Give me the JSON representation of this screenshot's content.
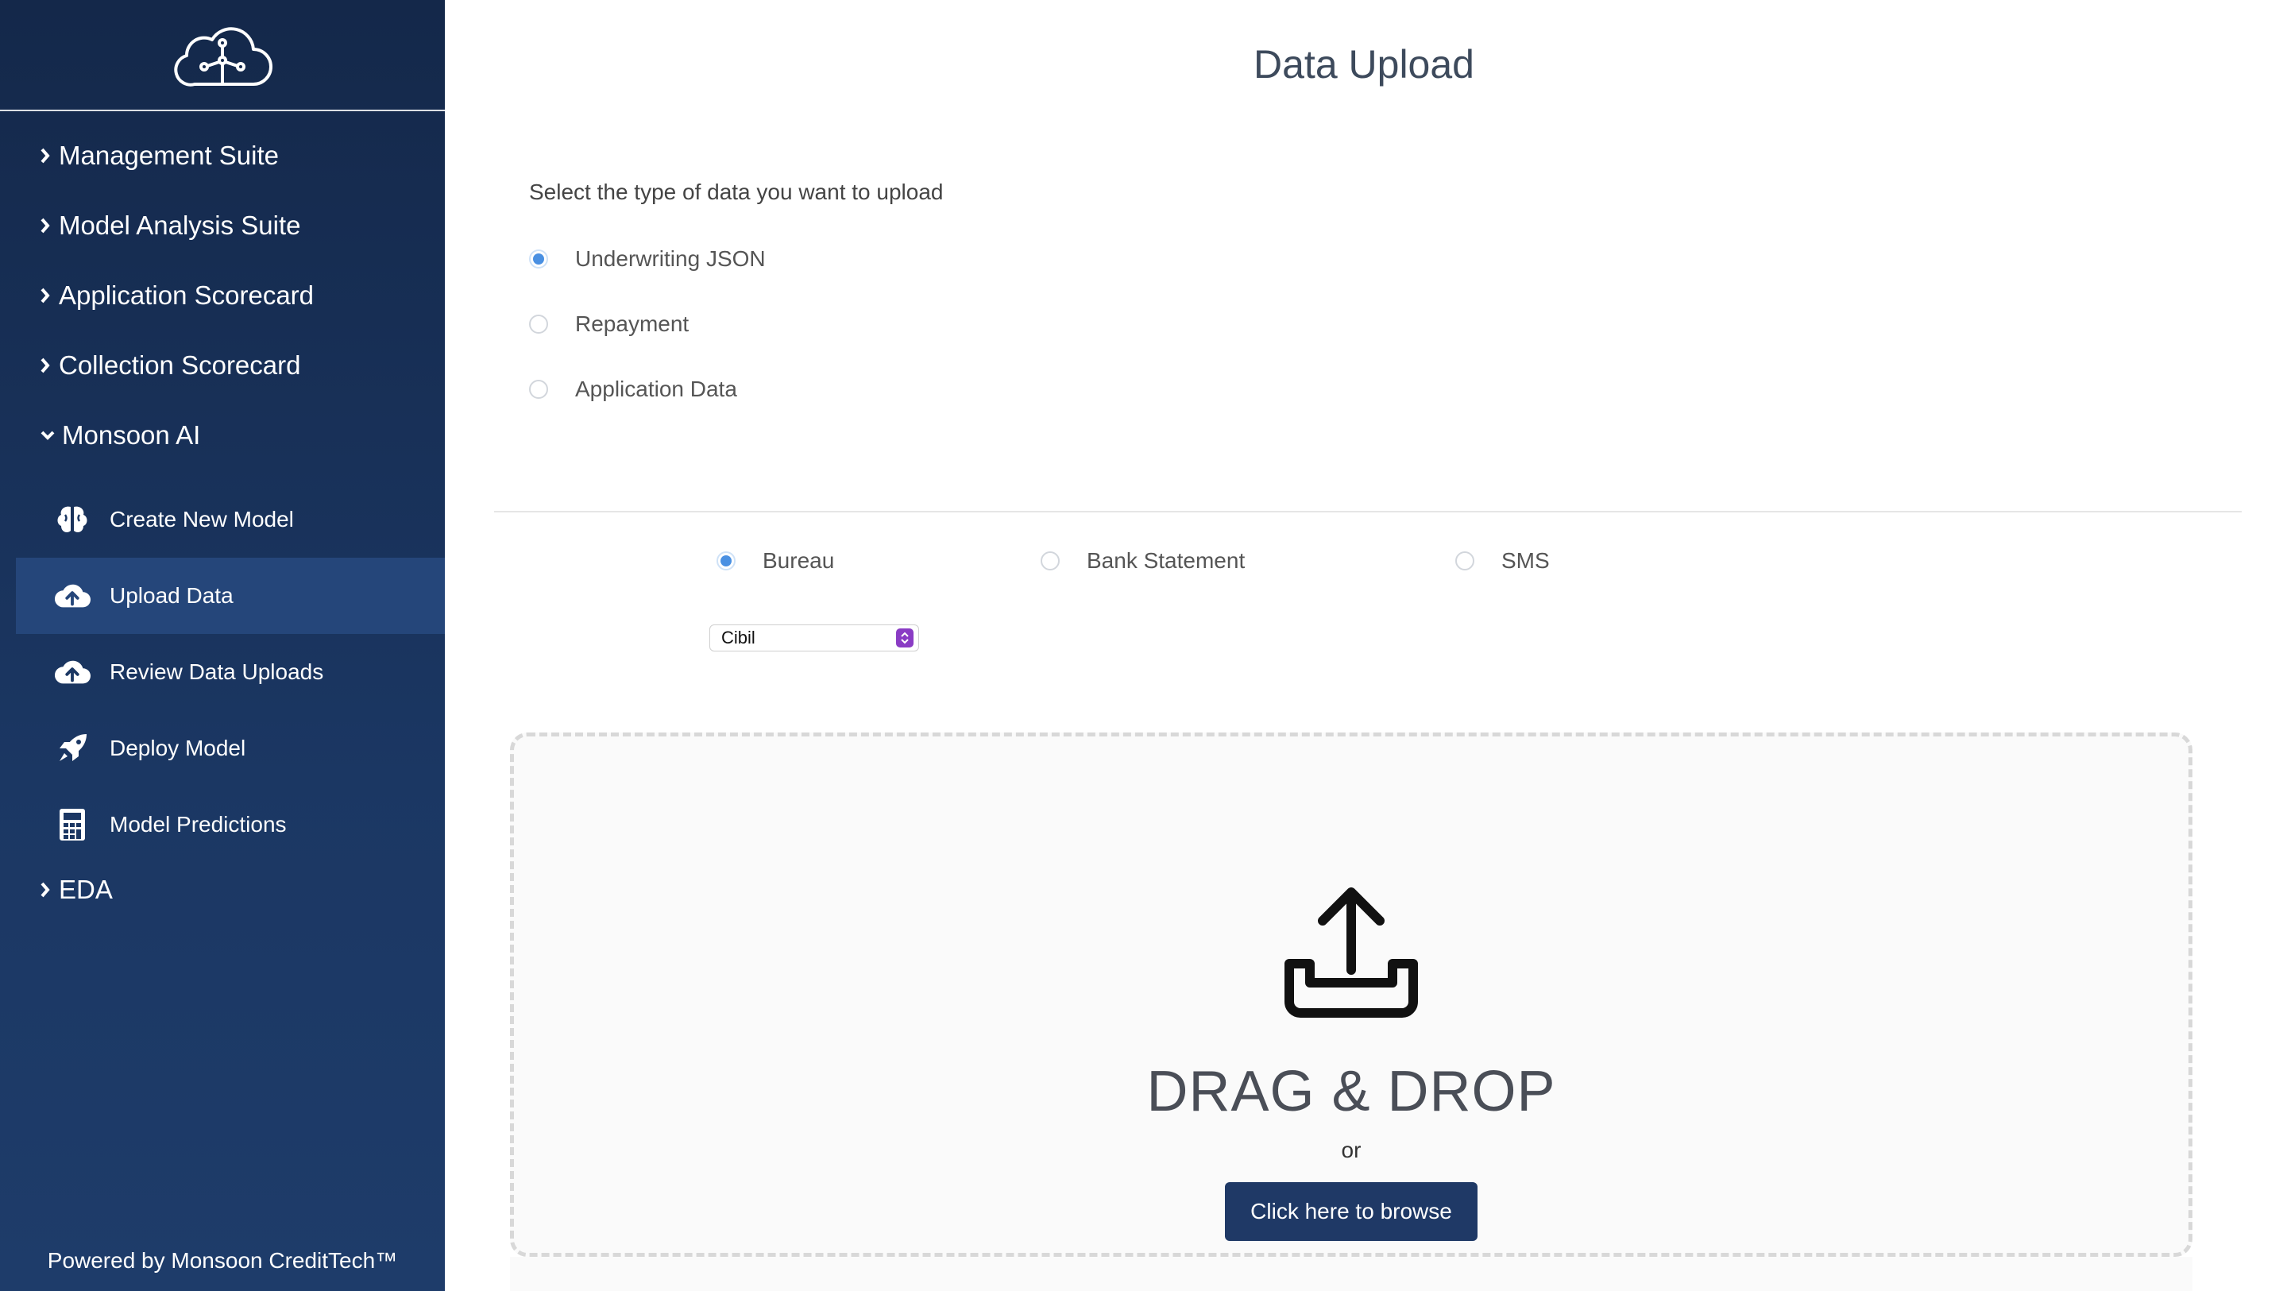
{
  "sidebar": {
    "logo_icon": "cloud-network-icon",
    "items": [
      {
        "label": "Management Suite",
        "expanded": false
      },
      {
        "label": "Model Analysis Suite",
        "expanded": false
      },
      {
        "label": "Application Scorecard",
        "expanded": false
      },
      {
        "label": "Collection Scorecard",
        "expanded": false
      },
      {
        "label": "Monsoon AI",
        "expanded": true
      }
    ],
    "sub_items": [
      {
        "label": "Create New Model",
        "icon": "brain-icon"
      },
      {
        "label": "Upload Data",
        "icon": "cloud-upload-icon",
        "active": true
      },
      {
        "label": "Review Data Uploads",
        "icon": "cloud-upload-icon"
      },
      {
        "label": "Deploy Model",
        "icon": "rocket-icon"
      },
      {
        "label": "Model Predictions",
        "icon": "calculator-icon"
      }
    ],
    "bottom_item": {
      "label": "EDA",
      "expanded": false
    },
    "footer": "Powered by Monsoon CreditTech™"
  },
  "main": {
    "title": "Data Upload",
    "prompt": "Select the type of data you want to upload",
    "data_types": [
      {
        "label": "Underwriting JSON",
        "checked": true
      },
      {
        "label": "Repayment",
        "checked": false
      },
      {
        "label": "Application Data",
        "checked": false
      }
    ],
    "sources": [
      {
        "label": "Bureau",
        "checked": true
      },
      {
        "label": "Bank Statement",
        "checked": false
      },
      {
        "label": "SMS",
        "checked": false
      }
    ],
    "bureau_select": {
      "value": "Cibil"
    },
    "dropzone": {
      "icon": "upload-tray-icon",
      "heading": "DRAG & DROP",
      "or": "or",
      "browse_label": "Click here to browse"
    }
  },
  "colors": {
    "sidebar_bg": "#1b3763",
    "sidebar_active": "#25467a",
    "accent_radio": "#4a90e2",
    "button_bg": "#1f3966",
    "select_arrow": "#8a3cc4"
  }
}
